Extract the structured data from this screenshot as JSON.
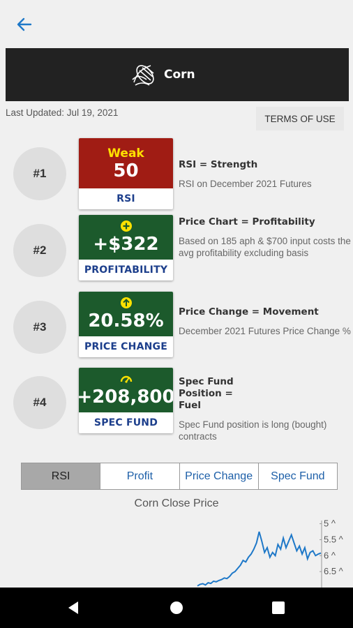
{
  "header": {
    "title": "Corn"
  },
  "last_updated": "Last Updated: Jul 19, 2021",
  "terms_label": "TERMS OF USE",
  "metrics": [
    {
      "rank": "#1",
      "status": "Weak",
      "value": "50",
      "label": "RSI",
      "heading": "RSI = Strength",
      "description": "RSI on December 2021 Futures",
      "color": "#a01c14"
    },
    {
      "rank": "#2",
      "value": "+$322",
      "label": "PROFITABILITY",
      "heading": "Price Chart = Profitability",
      "description": "Based on 185 aph & $700 input costs the avg profitability excluding basis",
      "icon": "plus-circle-icon",
      "color": "#1c5a2c"
    },
    {
      "rank": "#3",
      "value": "20.58%",
      "label": "PRICE CHANGE",
      "heading": "Price Change = Movement",
      "description": "December 2021 Futures Price Change %",
      "icon": "arrow-up-circle-icon",
      "color": "#1c5a2c"
    },
    {
      "rank": "#4",
      "value": "+208,800",
      "label": "SPEC FUND",
      "heading": "Spec Fund Position = Fuel",
      "description": "Spec Fund position is long (bought) contracts",
      "icon": "gauge-icon",
      "color": "#1c5a2c"
    }
  ],
  "tabs": [
    "RSI",
    "Profit",
    "Price Change",
    "Spec Fund"
  ],
  "active_tab": "RSI",
  "chart": {
    "title": "Corn Close Price",
    "y_ticks": [
      "6.5 ^",
      "6 ^",
      "5.5 ^",
      "5 ^"
    ],
    "series_color": "#1e78c8"
  },
  "chart_data": {
    "type": "line",
    "title": "Corn Close Price",
    "ylim": [
      4.5,
      6.6
    ],
    "y_ticks": [
      5,
      5.5,
      6,
      6.5
    ],
    "values": [
      4.55,
      4.6,
      4.62,
      4.58,
      4.65,
      4.63,
      4.7,
      4.68,
      4.72,
      4.75,
      4.8,
      4.78,
      4.85,
      4.95,
      5.0,
      5.1,
      5.2,
      5.35,
      5.3,
      5.45,
      5.55,
      5.7,
      5.9,
      6.25,
      5.95,
      5.6,
      5.75,
      5.45,
      5.6,
      5.5,
      5.85,
      5.7,
      6.05,
      5.75,
      5.95,
      6.15,
      5.9,
      5.65,
      5.8,
      5.55,
      5.75,
      5.4,
      5.6,
      5.65,
      5.5,
      5.55,
      5.58
    ]
  }
}
